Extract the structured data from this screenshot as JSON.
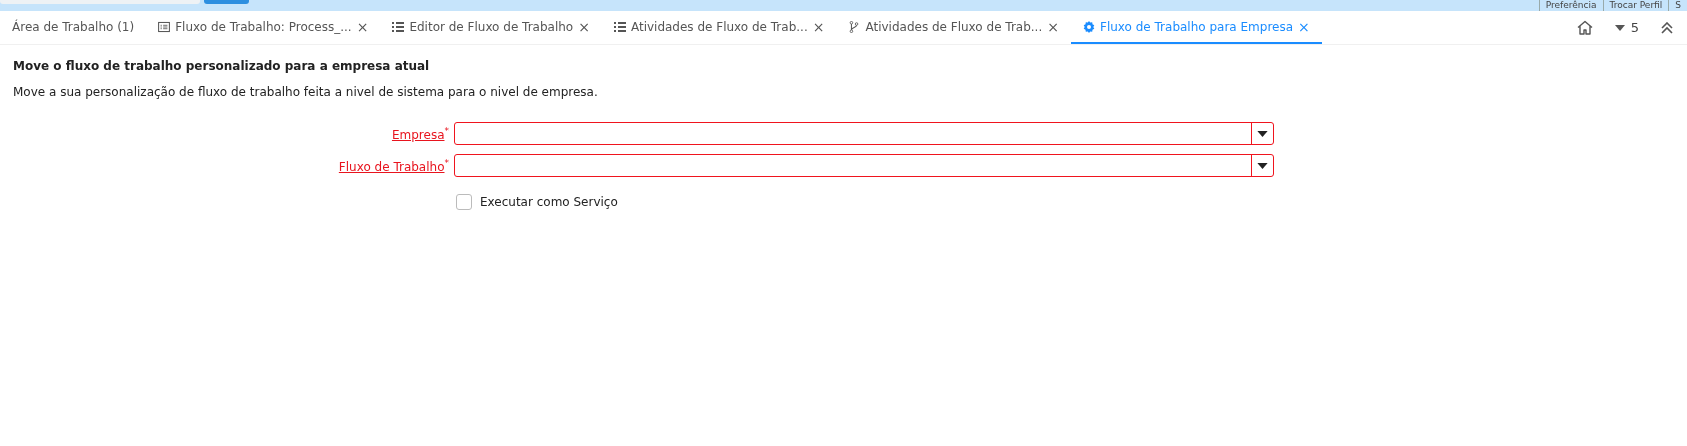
{
  "header_links": [
    "Preferência",
    "Trocar Perfil",
    "S"
  ],
  "tabs": [
    {
      "label": "Área de Trabalho (1)",
      "kind": "plain",
      "closable": false,
      "selected": false
    },
    {
      "label": "Fluxo de Trabalho: Process_...",
      "kind": "document",
      "closable": true,
      "selected": false
    },
    {
      "label": "Editor de Fluxo de Trabalho",
      "kind": "list",
      "closable": true,
      "selected": false
    },
    {
      "label": "Atividades de Fluxo de Trab...",
      "kind": "list",
      "closable": true,
      "selected": false
    },
    {
      "label": "Atividades de Fluxo de Trab...",
      "kind": "branch",
      "closable": true,
      "selected": false
    },
    {
      "label": "Fluxo de Trabalho para Empresa",
      "kind": "gear",
      "closable": true,
      "selected": true
    }
  ],
  "tab_count": "5",
  "close_glyph": "×",
  "form": {
    "title": "Move o fluxo de trabalho personalizado para a empresa atual",
    "description": "Move a sua personalização de fluxo de trabalho feita a nivel de sistema para o nivel de empresa.",
    "fields": [
      {
        "label": "Empresa",
        "required": true
      },
      {
        "label": "Fluxo de Trabalho",
        "required": true
      }
    ],
    "required_mark": "*",
    "checkbox": {
      "label": "Executar como Serviço",
      "checked": false
    }
  }
}
